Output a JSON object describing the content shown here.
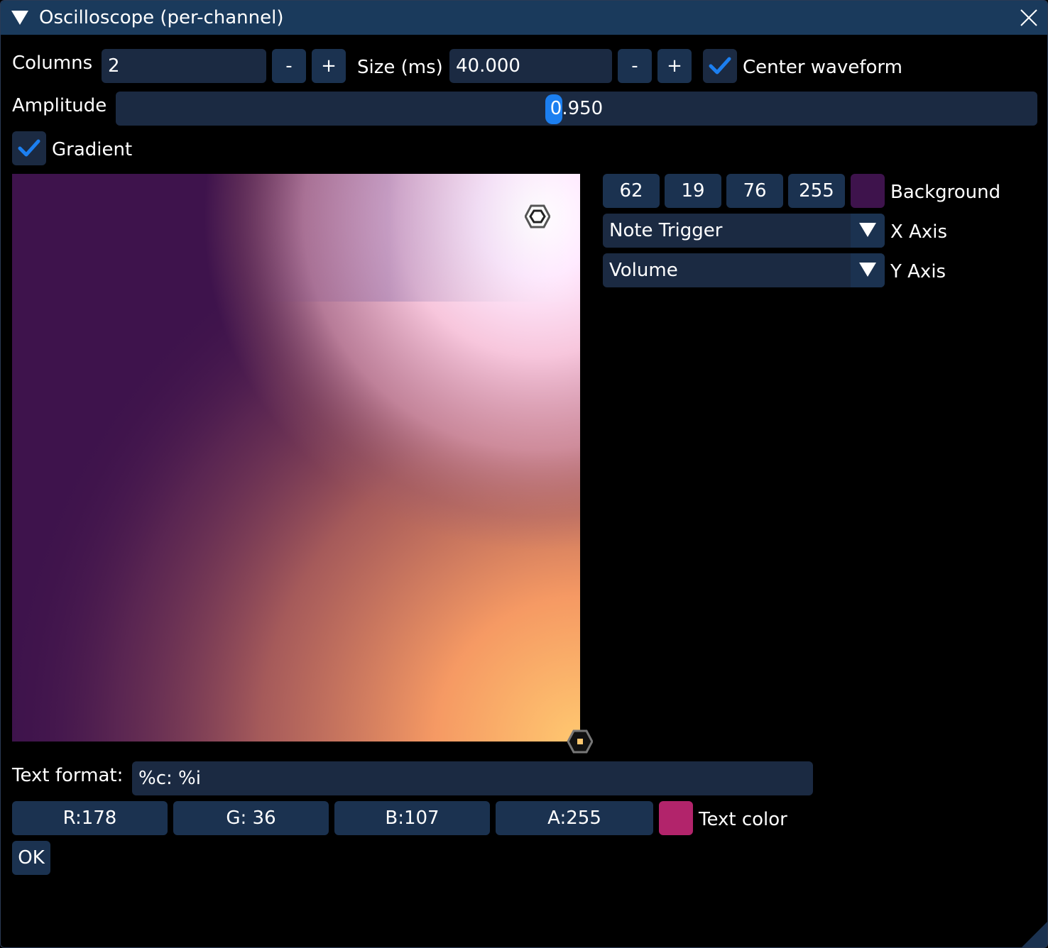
{
  "window": {
    "title": "Oscilloscope (per-channel)"
  },
  "colors": {
    "title_bar": "#1a3a5c",
    "field_bg": "#1b2a42",
    "button_bg": "#1b3250",
    "accent": "#1c7ff0",
    "background_color": "#3e134c",
    "text_color": "#b2246b",
    "gradient_top_right": "#ffffff",
    "gradient_bottom_right": "#ffc870"
  },
  "icons": {
    "collapse": "triangle-down-icon",
    "close": "close-x-icon",
    "checkmark": "checkmark-icon",
    "combo_arrow": "triangle-down-icon",
    "gradient_point": "hexagon-handle-icon",
    "resize": "resize-grip-icon"
  },
  "row1": {
    "columns_label": "Columns",
    "columns_value": "2",
    "minus": "-",
    "plus": "+",
    "size_label": "Size (ms)",
    "size_value": "40.000",
    "center_waveform_label": "Center waveform",
    "center_waveform_checked": true
  },
  "amplitude": {
    "label": "Amplitude",
    "value_text": "0.950",
    "value": 0.95
  },
  "gradient": {
    "label": "Gradient",
    "checked": true
  },
  "background": {
    "r": "62",
    "g": "19",
    "b": "76",
    "a": "255",
    "label": "Background"
  },
  "x_axis": {
    "value": "Note Trigger",
    "label": "X Axis"
  },
  "y_axis": {
    "value": "Volume",
    "label": "Y Axis"
  },
  "text_format": {
    "label": "Text format:",
    "value": "%c: %i"
  },
  "text_color": {
    "r": "R:178",
    "g": "G: 36",
    "b": "B:107",
    "a": "A:255",
    "label": "Text color"
  },
  "ok_label": "OK"
}
